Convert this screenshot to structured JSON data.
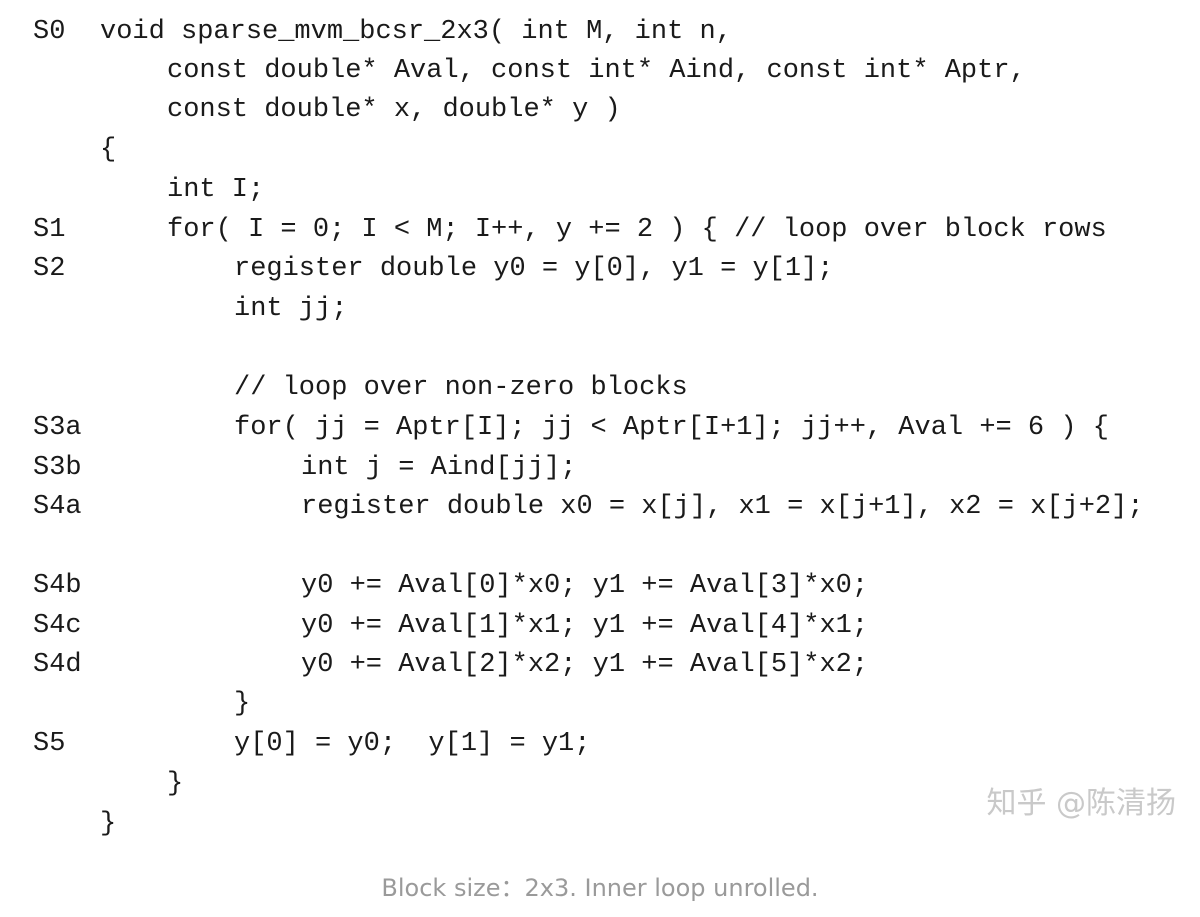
{
  "code_lines": [
    {
      "label": "S0",
      "code": "void sparse_mvm_bcsr_2x3( int M, int n,"
    },
    {
      "label": "",
      "code": "          const double* Aval, const int* Aind, const int* Aptr,"
    },
    {
      "label": "",
      "code": "          const double* x, double* y )"
    },
    {
      "label": "",
      "code": "{"
    },
    {
      "label": "",
      "code": "          int I;"
    },
    {
      "label": "S1",
      "code": "          for( I = 0; I < M; I++, y += 2 ) { // loop over block rows"
    },
    {
      "label": "S2",
      "code": "                    register double y0 = y[0], y1 = y[1];"
    },
    {
      "label": "",
      "code": "                    int jj;"
    },
    {
      "label": "",
      "code": ""
    },
    {
      "label": "",
      "code": "                    // loop over non-zero blocks"
    },
    {
      "label": "S3a",
      "code": "                    for( jj = Aptr[I]; jj < Aptr[I+1]; jj++, Aval += 6 ) {"
    },
    {
      "label": "S3b",
      "code": "                              int j = Aind[jj];"
    },
    {
      "label": "S4a",
      "code": "                              register double x0 = x[j], x1 = x[j+1], x2 = x[j+2];"
    },
    {
      "label": "",
      "code": ""
    },
    {
      "label": "S4b",
      "code": "                              y0 += Aval[0]*x0; y1 += Aval[3]*x0;"
    },
    {
      "label": "S4c",
      "code": "                              y0 += Aval[1]*x1; y1 += Aval[4]*x1;"
    },
    {
      "label": "S4d",
      "code": "                              y0 += Aval[2]*x2; y1 += Aval[5]*x2;"
    },
    {
      "label": "",
      "code": "                    }"
    },
    {
      "label": "S5",
      "code": "                    y[0] = y0;  y[1] = y1;"
    },
    {
      "label": "",
      "code": "          }"
    },
    {
      "label": "",
      "code": "}"
    }
  ],
  "watermark": "知乎 @陈清扬",
  "caption": "Block size：2x3. Inner loop unrolled."
}
